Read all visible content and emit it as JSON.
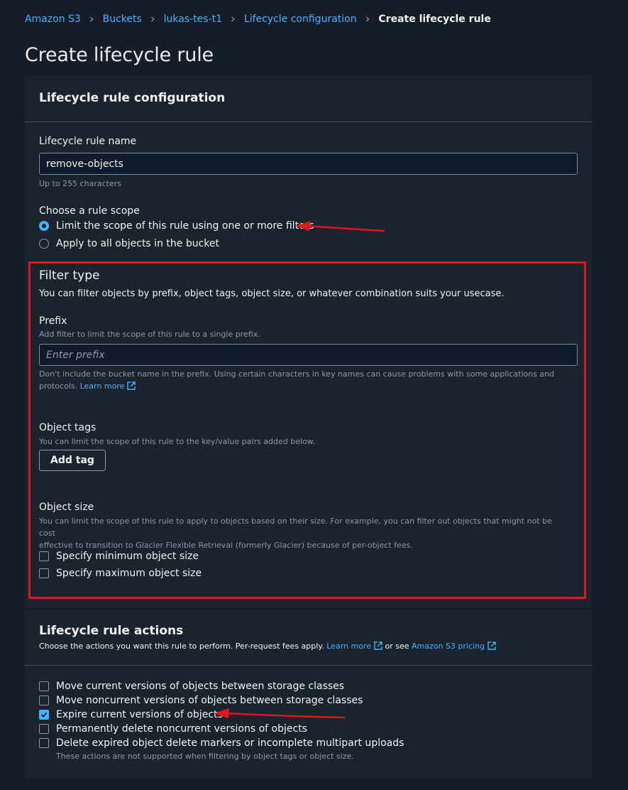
{
  "breadcrumb": {
    "items": [
      "Amazon S3",
      "Buckets",
      "lukas-tes-t1",
      "Lifecycle configuration"
    ],
    "current": "Create lifecycle rule"
  },
  "page_title": "Create lifecycle rule",
  "config": {
    "title": "Lifecycle rule configuration",
    "name_label": "Lifecycle rule name",
    "name_value": "remove-objects",
    "name_hint": "Up to 255 characters",
    "scope_label": "Choose a rule scope",
    "scope_options": [
      "Limit the scope of this rule using one or more filters",
      "Apply to all objects in the bucket"
    ],
    "scope_selected": 0
  },
  "filter": {
    "title": "Filter type",
    "description": "You can filter objects by prefix, object tags, object size, or whatever combination suits your usecase.",
    "prefix_label": "Prefix",
    "prefix_desc": "Add filter to limit the scope of this rule to a single prefix.",
    "prefix_placeholder": "Enter prefix",
    "prefix_note": "Don't include the bucket name in the prefix. Using certain characters in key names can cause problems with some applications and protocols.",
    "learn_more": "Learn more",
    "tags_label": "Object tags",
    "tags_desc": "You can limit the scope of this rule to the key/value pairs added below.",
    "add_tag": "Add tag",
    "size_label": "Object size",
    "size_desc_1": "You can limit the scope of this rule to apply to objects based on their size. For example, you can filter out objects that might not be cost",
    "size_desc_2": "effective to transition to Glacier Flexible Retrieval (formerly Glacier) because of per-object fees.",
    "size_min": "Specify minimum object size",
    "size_max": "Specify maximum object size"
  },
  "actions": {
    "title": "Lifecycle rule actions",
    "desc_prefix": "Choose the actions you want this rule to perform. Per-request fees apply.",
    "learn_more": "Learn more",
    "or_see": "or see",
    "pricing": "Amazon S3 pricing",
    "items": [
      {
        "label": "Move current versions of objects between storage classes",
        "checked": false
      },
      {
        "label": "Move noncurrent versions of objects between storage classes",
        "checked": false
      },
      {
        "label": "Expire current versions of objects",
        "checked": true
      },
      {
        "label": "Permanently delete noncurrent versions of objects",
        "checked": false
      },
      {
        "label": "Delete expired object delete markers or incomplete multipart uploads",
        "checked": false
      }
    ],
    "footnote": "These actions are not supported when filtering by object tags or object size."
  },
  "colors": {
    "accent": "#42b4ff",
    "annotation": "#e0161e",
    "background": "#161d26",
    "panel": "#1b232d"
  }
}
